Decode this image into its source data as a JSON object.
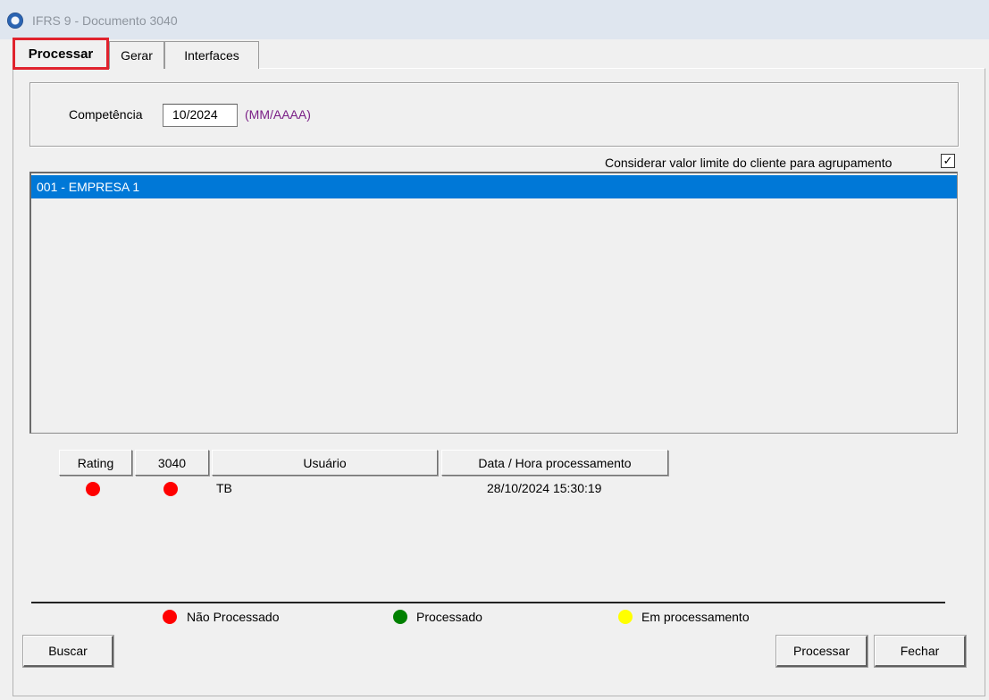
{
  "window": {
    "title": "IFRS 9 - Documento 3040"
  },
  "tabs": [
    {
      "label": "Processar",
      "active": true
    },
    {
      "label": "Gerar",
      "active": false
    },
    {
      "label": "Interfaces",
      "active": false
    }
  ],
  "form": {
    "competencia_label": "Competência",
    "competencia_value": "10/2024",
    "competencia_hint": "(MM/AAAA)",
    "agrupamento_label": "Considerar valor limite do cliente para agrupamento",
    "agrupamento_checked": true,
    "check_glyph": "✓"
  },
  "companies": [
    {
      "label": "001 - EMPRESA 1",
      "selected": true
    }
  ],
  "status_table": {
    "headers": [
      "Rating",
      "3040",
      "Usuário",
      "Data / Hora processamento"
    ],
    "row": {
      "rating_status": "nao-processado",
      "doc3040_status": "nao-processado",
      "usuario": "TB",
      "data_hora": "28/10/2024 15:30:19"
    }
  },
  "legend": [
    {
      "label": "Não Processado",
      "color": "#ff0000"
    },
    {
      "label": "Processado",
      "color": "#008000"
    },
    {
      "label": "Em processamento",
      "color": "#ffff00"
    }
  ],
  "buttons": {
    "buscar": "Buscar",
    "processar": "Processar",
    "fechar": "Fechar"
  }
}
